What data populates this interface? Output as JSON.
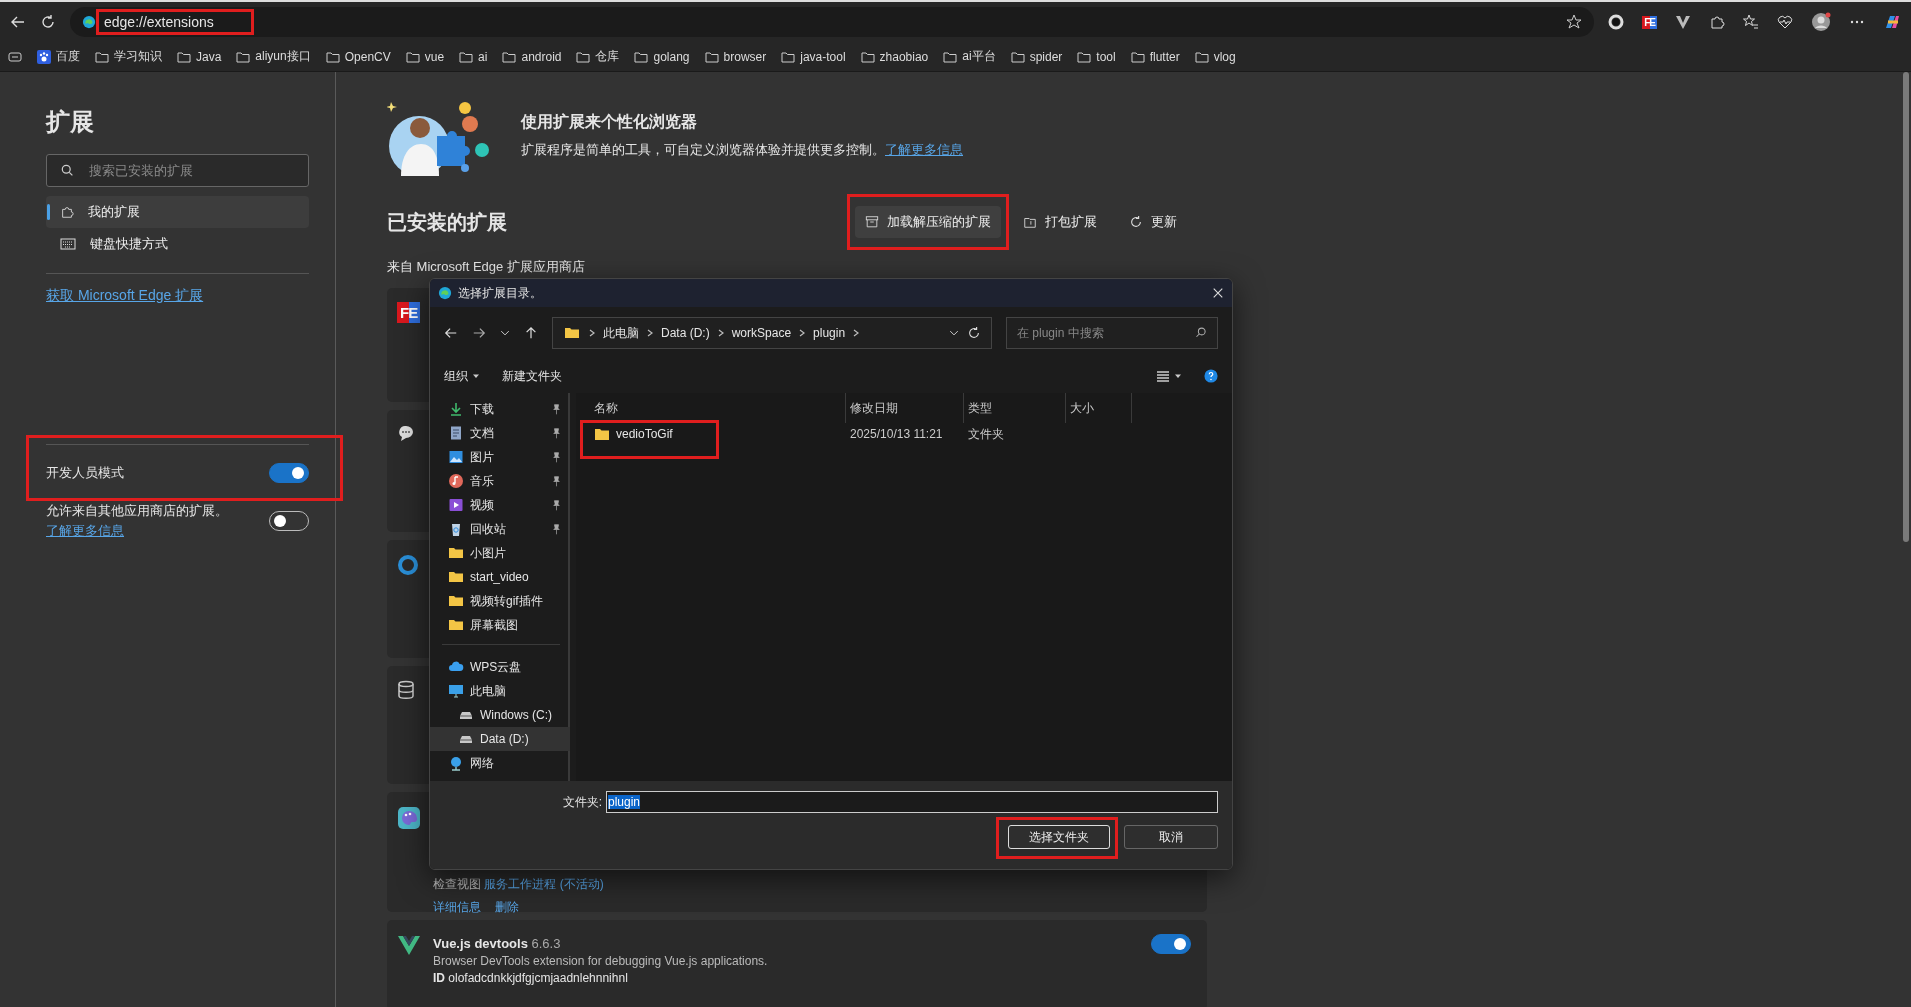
{
  "browser": {
    "address": "edge://extensions",
    "address_highlighted": true,
    "toolbar_badge": "FE"
  },
  "bookmarks": [
    {
      "label": "百度",
      "kind": "site"
    },
    {
      "label": "学习知识",
      "kind": "folder"
    },
    {
      "label": "Java",
      "kind": "folder"
    },
    {
      "label": "aliyun接口",
      "kind": "folder"
    },
    {
      "label": "OpenCV",
      "kind": "folder"
    },
    {
      "label": "vue",
      "kind": "folder"
    },
    {
      "label": "ai",
      "kind": "folder"
    },
    {
      "label": "android",
      "kind": "folder"
    },
    {
      "label": "仓库",
      "kind": "folder"
    },
    {
      "label": "golang",
      "kind": "folder"
    },
    {
      "label": "browser",
      "kind": "folder"
    },
    {
      "label": "java-tool",
      "kind": "folder"
    },
    {
      "label": "zhaobiao",
      "kind": "folder"
    },
    {
      "label": "ai平台",
      "kind": "folder"
    },
    {
      "label": "spider",
      "kind": "folder"
    },
    {
      "label": "tool",
      "kind": "folder"
    },
    {
      "label": "flutter",
      "kind": "folder"
    },
    {
      "label": "vlog",
      "kind": "folder"
    }
  ],
  "sidebar": {
    "title": "扩展",
    "search": {
      "placeholder": "搜索已安装的扩展"
    },
    "items": [
      {
        "label": "我的扩展",
        "kind": "puzzle",
        "selected": true
      },
      {
        "label": "键盘快捷方式",
        "kind": "keyboard",
        "selected": false
      }
    ],
    "store_link": "获取 Microsoft Edge 扩展",
    "settings": [
      {
        "label": "开发人员模式",
        "on": true,
        "highlighted": true
      },
      {
        "label": "允许来自其他应用商店的扩展。",
        "link": "了解更多信息",
        "on": false,
        "highlighted": false
      }
    ]
  },
  "intro": {
    "title": "使用扩展来个性化浏览器",
    "text": "扩展程序是简单的工具，可自定义浏览器体验并提供更多控制。",
    "link": "了解更多信息"
  },
  "installed": {
    "title": "已安装的扩展",
    "actions": [
      {
        "label": "加载解压缩的扩展",
        "kind": "box",
        "highlighted": true
      },
      {
        "label": "打包扩展",
        "kind": "pack",
        "highlighted": false
      },
      {
        "label": "更新",
        "kind": "refresh",
        "highlighted": false
      }
    ],
    "source": "来自 Microsoft Edge 扩展应用商店"
  },
  "extensions": [
    {
      "kind": "fe",
      "badge": "FE"
    },
    {
      "kind": "chat"
    },
    {
      "kind": "ring"
    },
    {
      "kind": "database"
    },
    {
      "kind": "palette",
      "inspect_label": "检查视图",
      "inspect_link": "服务工作进程 (不活动)",
      "links": [
        "详细信息",
        "删除"
      ]
    },
    {
      "kind": "vue",
      "name": "Vue.js devtools",
      "version": "6.6.3",
      "description": "Browser DevTools extension for debugging Vue.js applications.",
      "id_label": "ID",
      "id": "olofadcdnkkjdfgjcmjaadnlehnnihnl",
      "on": true
    }
  ],
  "dialog": {
    "title": "选择扩展目录。",
    "path": [
      "此电脑",
      "Data (D:)",
      "workSpace",
      "plugin"
    ],
    "search": {
      "placeholder": "在 plugin 中搜索"
    },
    "toolbar": {
      "organize": "组织",
      "new_folder": "新建文件夹"
    },
    "nav_groups": [
      [
        {
          "label": "下载",
          "kind": "download",
          "pinned": true,
          "selected": false
        },
        {
          "label": "文档",
          "kind": "document",
          "pinned": true,
          "selected": false
        },
        {
          "label": "图片",
          "kind": "image",
          "pinned": true,
          "selected": false
        },
        {
          "label": "音乐",
          "kind": "music",
          "pinned": true,
          "selected": false
        },
        {
          "label": "视频",
          "kind": "video",
          "pinned": true,
          "selected": false
        },
        {
          "label": "回收站",
          "kind": "bin",
          "pinned": true,
          "selected": false
        },
        {
          "label": "小图片",
          "kind": "folder",
          "pinned": false,
          "selected": false
        },
        {
          "label": "start_video",
          "kind": "folder",
          "pinned": false,
          "selected": false
        },
        {
          "label": "视频转gif插件",
          "kind": "folder",
          "pinned": false,
          "selected": false
        },
        {
          "label": "屏幕截图",
          "kind": "folder",
          "pinned": false,
          "selected": false
        }
      ],
      [
        {
          "label": "WPS云盘",
          "kind": "cloud",
          "pinned": false,
          "selected": false
        },
        {
          "label": "此电脑",
          "kind": "pc",
          "pinned": false,
          "selected": false,
          "children": [
            {
              "label": "Windows (C:)",
              "kind": "drive",
              "pinned": false,
              "selected": false
            },
            {
              "label": "Data (D:)",
              "kind": "drive",
              "pinned": false,
              "selected": true
            }
          ]
        },
        {
          "label": "网络",
          "kind": "network",
          "pinned": false,
          "selected": false
        }
      ]
    ],
    "columns": [
      "名称",
      "修改日期",
      "类型",
      "大小"
    ],
    "files": [
      {
        "name": "vedioToGif",
        "modified": "2025/10/13 11:21",
        "type": "文件夹",
        "selected": false,
        "highlighted": true
      }
    ],
    "footer": {
      "label": "文件夹:",
      "value": "plugin",
      "value_selected": true,
      "buttons": [
        {
          "label": "选择文件夹",
          "default": true,
          "highlighted": true
        },
        {
          "label": "取消",
          "default": false,
          "highlighted": false
        }
      ]
    }
  }
}
